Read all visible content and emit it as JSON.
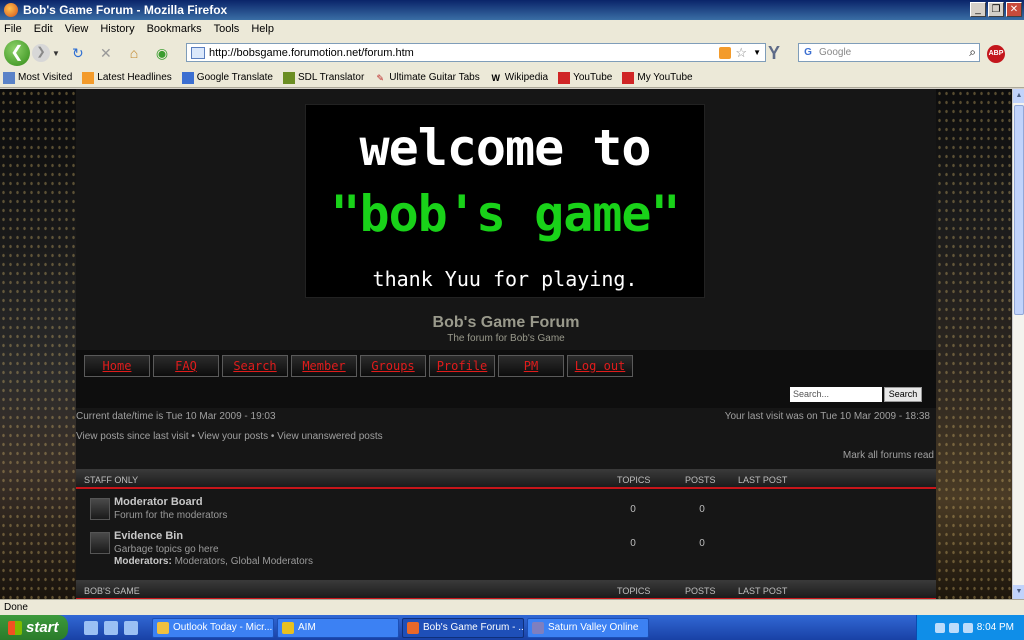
{
  "window": {
    "title": "Bob's Game Forum - Mozilla Firefox"
  },
  "menu": [
    "File",
    "Edit",
    "View",
    "History",
    "Bookmarks",
    "Tools",
    "Help"
  ],
  "nav": {
    "url": "http://bobsgame.forumotion.net/forum.htm",
    "search_placeholder": "Google"
  },
  "bookmarks": [
    "Most Visited",
    "Latest Headlines",
    "Google Translate",
    "SDL Translator",
    "Ultimate Guitar Tabs",
    "Wikipedia",
    "YouTube",
    "My YouTube"
  ],
  "banner": {
    "line1": "welcome to",
    "line2": "\"bob's game\"",
    "line3": "thank Yuu for playing."
  },
  "forum": {
    "title": "Bob's Game Forum",
    "subtitle": "The forum for Bob's Game",
    "nav_buttons": [
      "Home",
      "FAQ",
      "Search",
      "Member",
      "Groups",
      "Profile",
      "PM",
      "Log out"
    ],
    "search_placeholder": "Search...",
    "search_button": "Search",
    "current_time": "Current date/time is Tue 10 Mar 2009 - 19:03",
    "last_visit": "Your last visit was on Tue 10 Mar 2009 - 18:38",
    "links": {
      "since_last": "View posts since last visit",
      "your_posts": "View your posts",
      "unanswered": "View unanswered posts",
      "sep": " • "
    },
    "mark_read": "Mark all forums read",
    "columns": {
      "topics": "TOPICS",
      "posts": "POSTS",
      "last_post": "LAST POST"
    },
    "categories": [
      {
        "name": "STAFF ONLY",
        "forums": [
          {
            "name": "Moderator Board",
            "desc": "Forum for the moderators",
            "topics": "0",
            "posts": "0"
          },
          {
            "name": "Evidence Bin",
            "desc": "Garbage topics go here",
            "mods_label": "Moderators:",
            "mods": " Moderators, Global Moderators",
            "topics": "0",
            "posts": "0"
          }
        ]
      },
      {
        "name": "BOB'S GAME"
      }
    ]
  },
  "status": "Done",
  "taskbar": {
    "start": "start",
    "tasks": [
      "Outlook Today - Micr...",
      "AIM",
      "Bob's Game Forum - ...",
      "Saturn Valley Online"
    ],
    "clock": "8:04 PM"
  }
}
